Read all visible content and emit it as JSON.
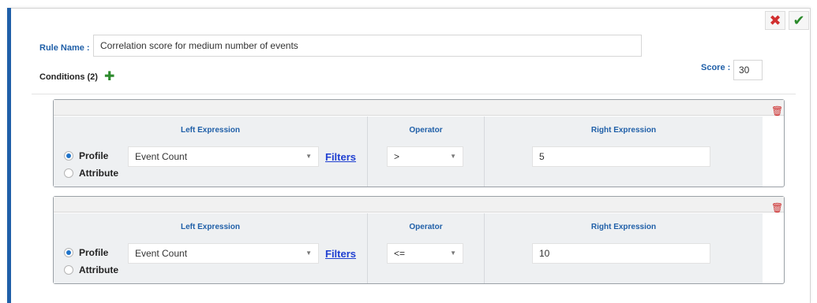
{
  "actions": {
    "cancel_icon": "close-icon",
    "confirm_icon": "check-icon"
  },
  "rule": {
    "name_label": "Rule Name :",
    "name_value": "Correlation score for medium number of events",
    "conditions_label": "Conditions (2)",
    "score_label": "Score :",
    "score_value": "30"
  },
  "conditions": [
    {
      "left_header": "Left Expression",
      "operator_header": "Operator",
      "right_header": "Right Expression",
      "radio_profile": "Profile",
      "radio_attribute": "Attribute",
      "selected_radio": "Profile",
      "left_value": "Event Count",
      "filters_link": "Filters",
      "operator_value": ">",
      "right_value": "5"
    },
    {
      "left_header": "Left Expression",
      "operator_header": "Operator",
      "right_header": "Right Expression",
      "radio_profile": "Profile",
      "radio_attribute": "Attribute",
      "selected_radio": "Profile",
      "left_value": "Event Count",
      "filters_link": "Filters",
      "operator_value": "<=",
      "right_value": "10"
    }
  ],
  "colors": {
    "accent": "#1f5fa8",
    "cancel": "#d12f2f",
    "confirm": "#2b8a2b",
    "delete": "#cc2929",
    "link": "#1f3fd1"
  }
}
